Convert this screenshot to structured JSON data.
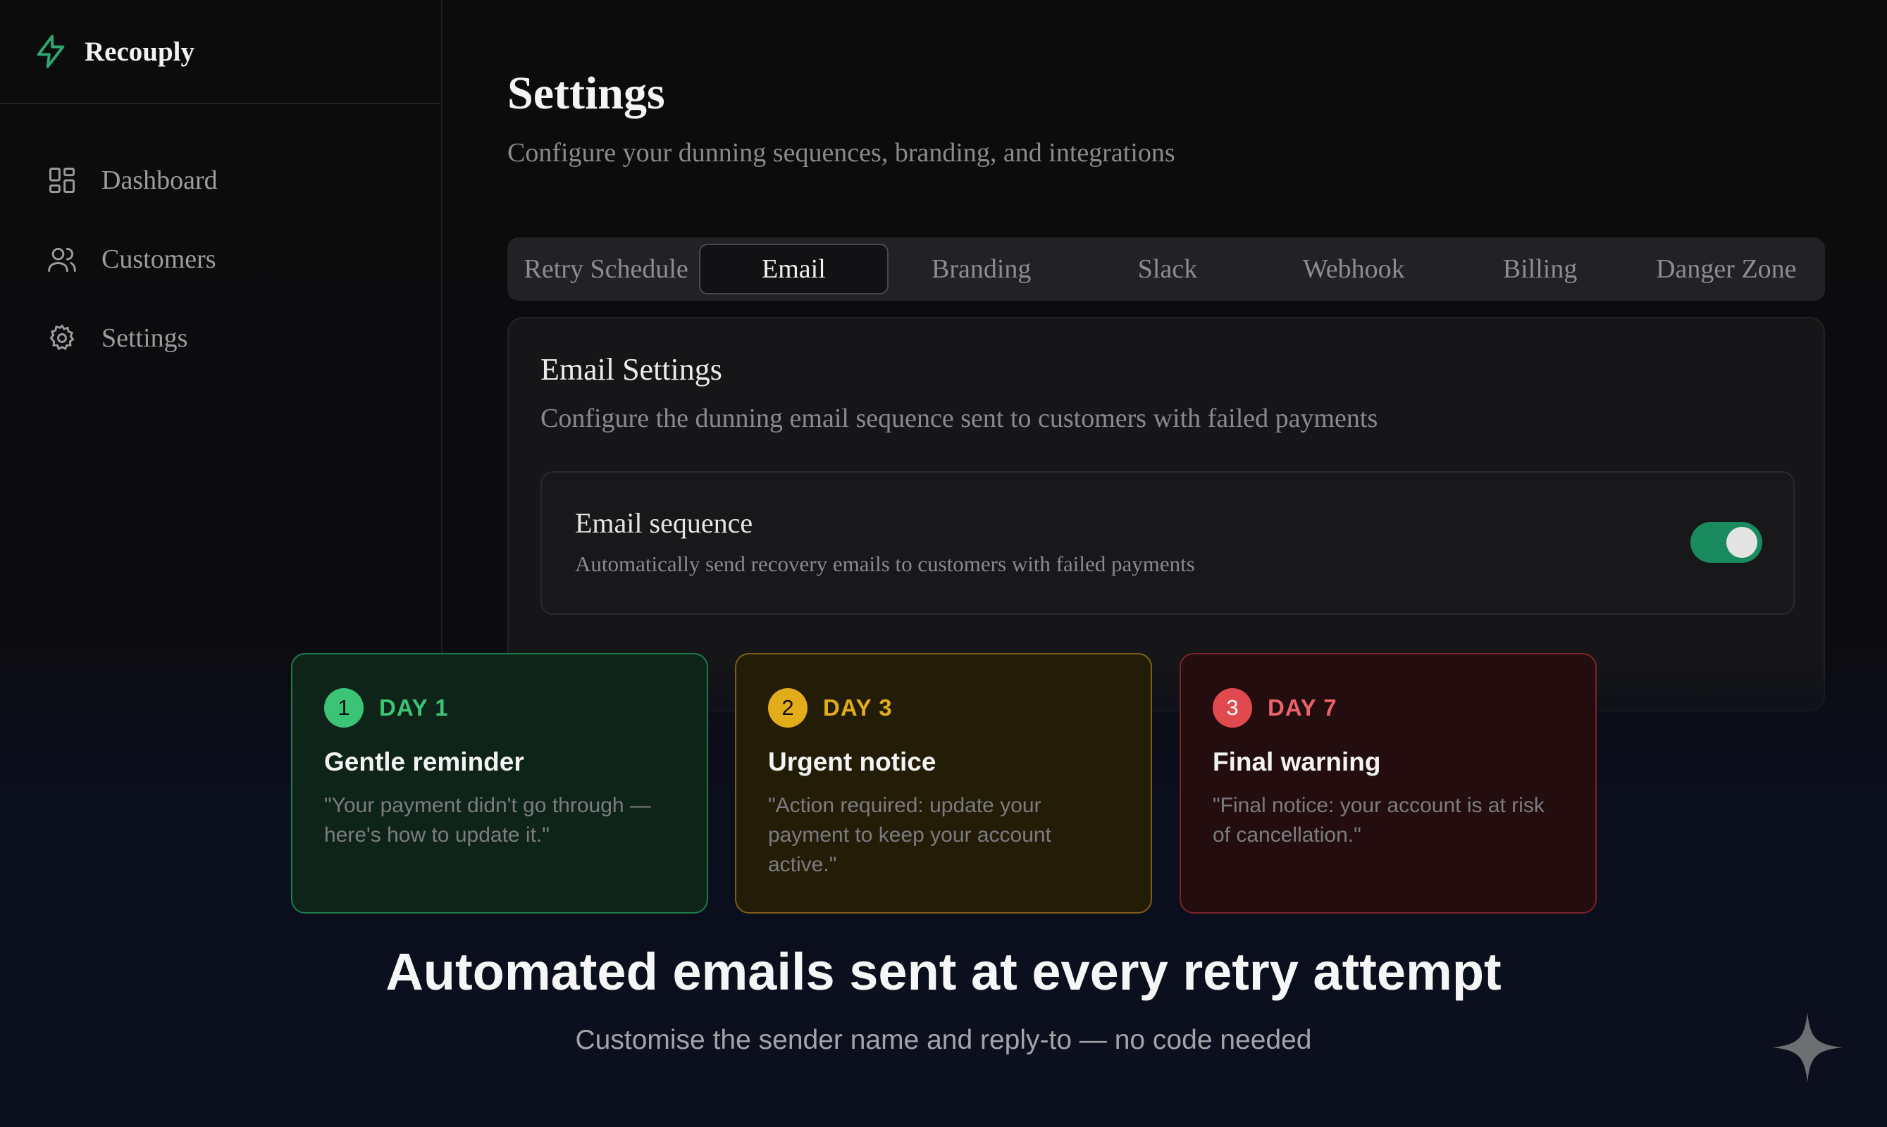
{
  "app": {
    "name": "Recouply"
  },
  "sidebar": {
    "items": [
      {
        "label": "Dashboard",
        "icon": "dashboard-grid-icon"
      },
      {
        "label": "Customers",
        "icon": "users-icon"
      },
      {
        "label": "Settings",
        "icon": "gear-icon"
      }
    ]
  },
  "header": {
    "title": "Settings",
    "subtitle": "Configure your dunning sequences, branding, and integrations"
  },
  "tabs": {
    "active": "Email",
    "items": [
      "Retry Schedule",
      "Email",
      "Branding",
      "Slack",
      "Webhook",
      "Billing",
      "Danger Zone"
    ]
  },
  "email_settings": {
    "title": "Email Settings",
    "subtitle": "Configure the dunning email sequence sent to customers with failed payments",
    "sequence": {
      "title": "Email sequence",
      "description": "Automatically send recovery emails to customers with failed payments",
      "enabled": true
    }
  },
  "steps": [
    {
      "number": "1",
      "day": "DAY 1",
      "title": "Gentle reminder",
      "quote": "\"Your payment didn't go through — here's how to update it.\"",
      "color": "#3cc476"
    },
    {
      "number": "2",
      "day": "DAY 3",
      "title": "Urgent notice",
      "quote": "\"Action required: update your payment to keep your account active.\"",
      "color": "#e3ac1a"
    },
    {
      "number": "3",
      "day": "DAY 7",
      "title": "Final warning",
      "quote": "\"Final notice: your account is at risk of cancellation.\"",
      "color": "#e04a4f"
    }
  ],
  "promo": {
    "headline": "Automated emails sent at every retry attempt",
    "subline": "Customise the sender name and reply-to — no code needed"
  },
  "colors": {
    "accent": "#1a8a5f",
    "brand_icon": "#2fa56f"
  }
}
